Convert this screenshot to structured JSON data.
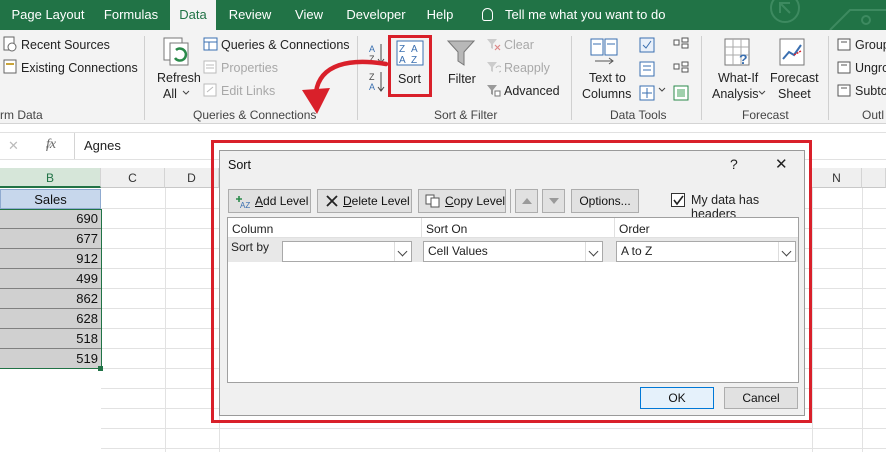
{
  "tabs": [
    "Page Layout",
    "Formulas",
    "Data",
    "Review",
    "View",
    "Developer",
    "Help"
  ],
  "tell_me": "Tell me what you want to do",
  "ribbon": {
    "recent_sources": "Recent Sources",
    "existing_connections": "Existing Connections",
    "get_data_group": "rm Data",
    "refresh_all_1": "Refresh",
    "refresh_all_2": "All",
    "queries_connections": "Queries & Connections",
    "properties": "Properties",
    "edit_links": "Edit Links",
    "queries_group": "Queries & Connections",
    "sort": "Sort",
    "filter": "Filter",
    "clear": "Clear",
    "reapply": "Reapply",
    "advanced": "Advanced",
    "sort_filter_group": "Sort & Filter",
    "text_to_columns_1": "Text to",
    "text_to_columns_2": "Columns",
    "data_tools_group": "Data Tools",
    "what_if_1": "What-If",
    "what_if_2": "Analysis",
    "forecast_sheet_1": "Forecast",
    "forecast_sheet_2": "Sheet",
    "forecast_group": "Forecast",
    "group": "Group",
    "ungroup": "Ungro",
    "subtotal": "Subto",
    "outline_group": "Outl"
  },
  "formula_bar": {
    "cancel": "✕",
    "enter": "✓",
    "fx": "fx",
    "value": "Agnes"
  },
  "columns": [
    "B",
    "C",
    "D",
    "N"
  ],
  "sheet": {
    "header": "Sales",
    "values": [
      "690",
      "677",
      "912",
      "499",
      "862",
      "628",
      "518",
      "519"
    ]
  },
  "dialog": {
    "title": "Sort",
    "help": "?",
    "close": "✕",
    "add_level_u": "A",
    "add_level_rest": "dd Level",
    "delete_level_u": "D",
    "delete_level_rest": "elete Level",
    "copy_level_u": "C",
    "copy_level_rest": "opy Level",
    "options": "Options...",
    "my_data_headers": "My data has headers",
    "col_column": "Column",
    "col_sort_on": "Sort On",
    "col_order": "Order",
    "sort_by": "Sort by",
    "sort_by_value": "",
    "sort_on_value": "Cell Values",
    "order_value": "A to Z",
    "ok": "OK",
    "cancel": "Cancel"
  },
  "colors": {
    "excel_green": "#217346",
    "highlight_red": "#d9202a",
    "selection_fill": "#d0d0d0"
  }
}
